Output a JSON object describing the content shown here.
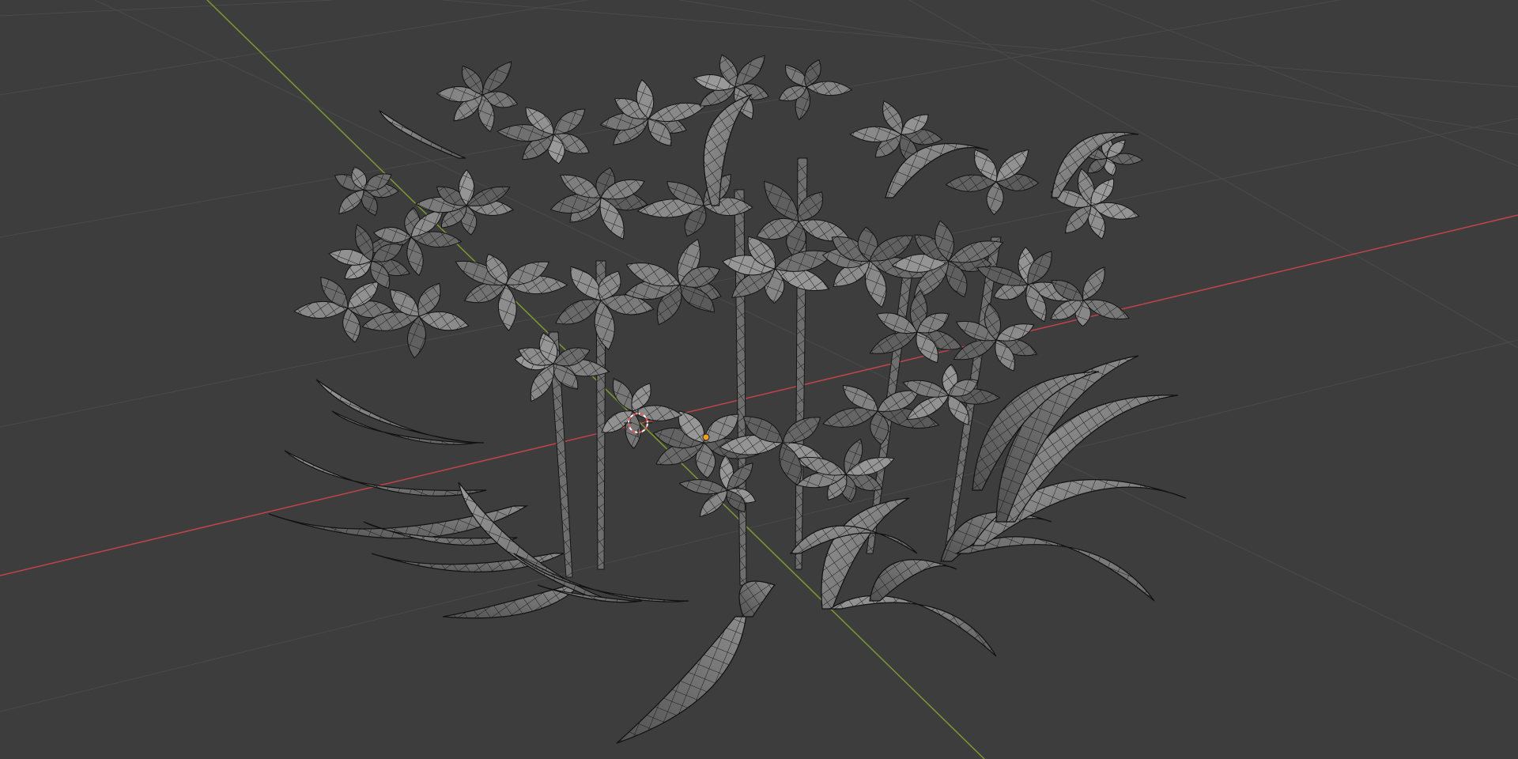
{
  "viewport": {
    "background_color": "#3d3d3d",
    "grid_line_color": "#4a4a4a",
    "x_axis_color": "#c0444a",
    "y_axis_color": "#7a9a34",
    "mesh_fill_color": "#808080",
    "mesh_wire_color": "#1a1a1a",
    "cursor_color": "#e06060",
    "origin_color": "#f0a020",
    "objects": [
      {
        "name": "flower-bush-mesh",
        "display": "wireframe-over-solid"
      }
    ],
    "gizmos": [
      "3d-cursor-icon",
      "object-origin-dot"
    ]
  }
}
